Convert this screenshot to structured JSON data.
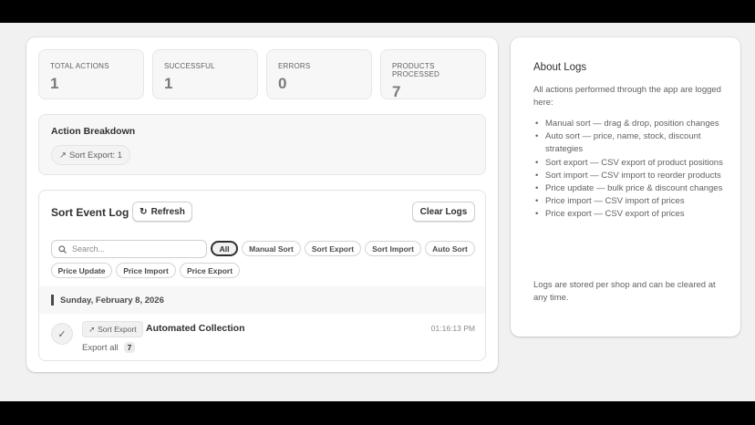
{
  "stats": [
    {
      "label": "TOTAL ACTIONS",
      "value": "1"
    },
    {
      "label": "SUCCESSFUL",
      "value": "1"
    },
    {
      "label": "ERRORS",
      "value": "0"
    },
    {
      "label": "PRODUCTS PROCESSED",
      "value": "7"
    }
  ],
  "breakdown": {
    "title": "Action Breakdown",
    "chip": "Sort Export: 1",
    "chip_icon": "arrow-up-right-icon"
  },
  "log": {
    "title": "Sort Event Log",
    "refresh_label": "Refresh",
    "refresh_icon": "refresh-icon",
    "clear_label": "Clear Logs",
    "search_placeholder": "Search...",
    "filters": [
      "All",
      "Manual Sort",
      "Sort Export",
      "Sort Import",
      "Auto Sort",
      "Price Update",
      "Price Import",
      "Price Export"
    ],
    "active_filter": "All",
    "date_group": "Sunday, February 8, 2026",
    "events": [
      {
        "status_icon": "checkmark-icon",
        "type_label": "Sort Export",
        "type_icon": "arrow-up-right-icon",
        "title": "Automated Collection",
        "time": "01:16:13 PM",
        "detail": "Export all",
        "count": "7"
      }
    ]
  },
  "about": {
    "title": "About Logs",
    "intro": "All actions performed through the app are logged here:",
    "items": [
      "Manual sort — drag & drop, position changes",
      "Auto sort — price, name, stock, discount strategies",
      "Sort export — CSV export of product positions",
      "Sort import — CSV import to reorder products",
      "Price update — bulk price & discount changes",
      "Price import — CSV import of prices",
      "Price export — CSV export of prices"
    ],
    "footer": "Logs are stored per shop and can be cleared at any time."
  },
  "colors": {
    "page_bg": "#f1f1f1",
    "card_bg": "#ffffff",
    "text_primary": "#303030",
    "text_secondary": "#616161"
  }
}
